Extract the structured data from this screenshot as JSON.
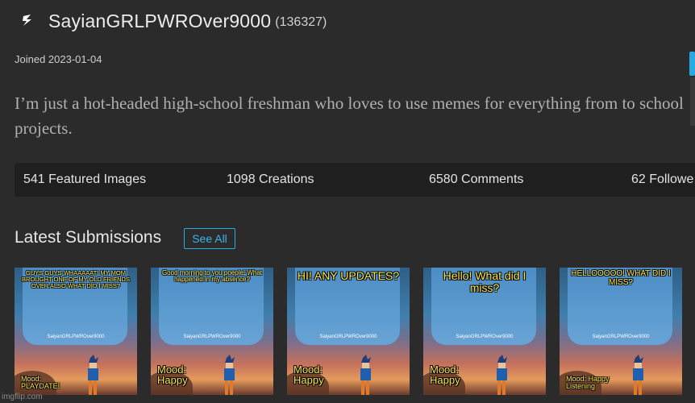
{
  "profile": {
    "username": "SayianGRLPWROver9000",
    "points": "(136327)",
    "joined": "Joined 2023-01-04",
    "bio": "I’m just a hot-headed high-school freshman who loves to use memes for everything from to school projects."
  },
  "stats": {
    "featured": "541 Featured Images",
    "creations": "1098 Creations",
    "comments": "6580 Comments",
    "followers": "62 Followe"
  },
  "submissions": {
    "title": "Latest Submissions",
    "see_all": "See All",
    "items": [
      {
        "caption": "GUYS GUYS WHAAAAAT! MY MOM BROUGHT ONE OF MY OLD FRIENDS OVER ALSO WHAT DID I MISS?",
        "handle": "SaiyanGRLPWROver9000",
        "mood": "Mood: PLAYDATE!"
      },
      {
        "caption": "Good morning to you poeple! What happened in my absence?",
        "handle": "SaiyanGRLPWROver9000",
        "mood": "Mood: Happy"
      },
      {
        "caption": "HI! ANY UPDATES?",
        "handle": "SaiyanGRLPWROver9000",
        "mood": "Mood: Happy"
      },
      {
        "caption": "Hello! What did I miss?",
        "handle": "SaiyanGRLPWROver9000",
        "mood": "Mood: Happy"
      },
      {
        "caption": "HELLOOOOO! WHAT DID I MISS?",
        "handle": "SaiyanGRLPWROver9000",
        "mood": "Mood: Happy Listening"
      }
    ]
  },
  "footer": {
    "watermark": "imgflip.com"
  },
  "colors": {
    "background": "#2b2b2b",
    "stats_bar": "#1f1f1f",
    "accent": "#2aa8e0",
    "caption": "#ffe94a"
  },
  "icons": {
    "avatar": "lightning-bolt-icon"
  }
}
